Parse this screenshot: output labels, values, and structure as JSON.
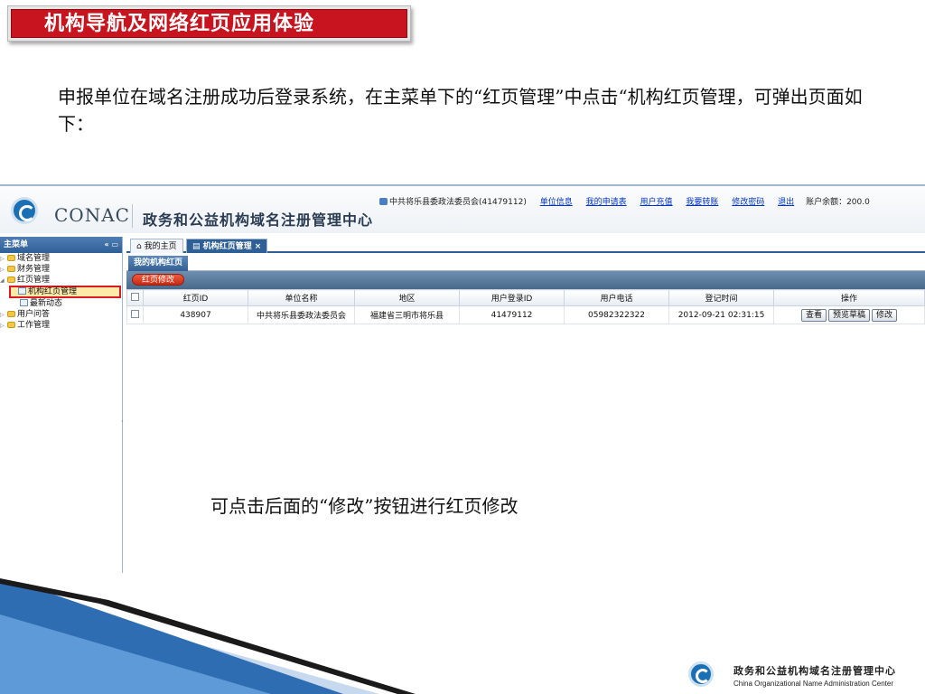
{
  "slide": {
    "title": "机构导航及网络红页应用体验",
    "intro": "申报单位在域名注册成功后登录系统，在主菜单下的“红页管理”中点击“机构红页管理，可弹出页面如下：",
    "note": "可点击后面的“修改”按钮进行红页修改"
  },
  "app": {
    "brand": "CONAC",
    "system_title": "政务和公益机构域名注册管理中心",
    "user_label": "中共将乐县委政法委员会(41479112)",
    "links": [
      "单位信息",
      "我的申请表",
      "用户充值",
      "我要转账",
      "修改密码",
      "退出"
    ],
    "balance": "账户余额：200.0"
  },
  "sidebar": {
    "header": "主菜单",
    "items": [
      {
        "label": "域名管理",
        "type": "folder"
      },
      {
        "label": "财务管理",
        "type": "folder"
      },
      {
        "label": "红页管理",
        "type": "folder-open"
      },
      {
        "label": "机构红页管理",
        "type": "page"
      },
      {
        "label": "最新动态",
        "type": "page"
      },
      {
        "label": "用户问答",
        "type": "folder"
      },
      {
        "label": "工作管理",
        "type": "folder"
      }
    ]
  },
  "tabs": [
    {
      "label": "我的主页",
      "icon": "home-icon"
    },
    {
      "label": "机构红页管理 ×",
      "icon": "page-icon"
    }
  ],
  "subtab": "我的机构红页",
  "toolbar": {
    "edit_label": "红页修改"
  },
  "table": {
    "columns": [
      "红页ID",
      "单位名称",
      "地区",
      "用户登录ID",
      "用户电话",
      "登记时间",
      "操作"
    ],
    "rows": [
      {
        "id": "438907",
        "name": "中共将乐县委政法委员会",
        "region": "福建省三明市将乐县",
        "login_id": "41479112",
        "phone": "05982322322",
        "time": "2012-09-21 02:31:15",
        "ops": [
          "查看",
          "预览草稿",
          "修改"
        ]
      }
    ]
  },
  "footer": {
    "cn": "政务和公益机构域名注册管理中心",
    "en": "China Organizational Name Administration Center"
  },
  "colors": {
    "title_red": "#c8141e",
    "nav_blue": "#2e5f97",
    "highlight": "#d81c24"
  }
}
